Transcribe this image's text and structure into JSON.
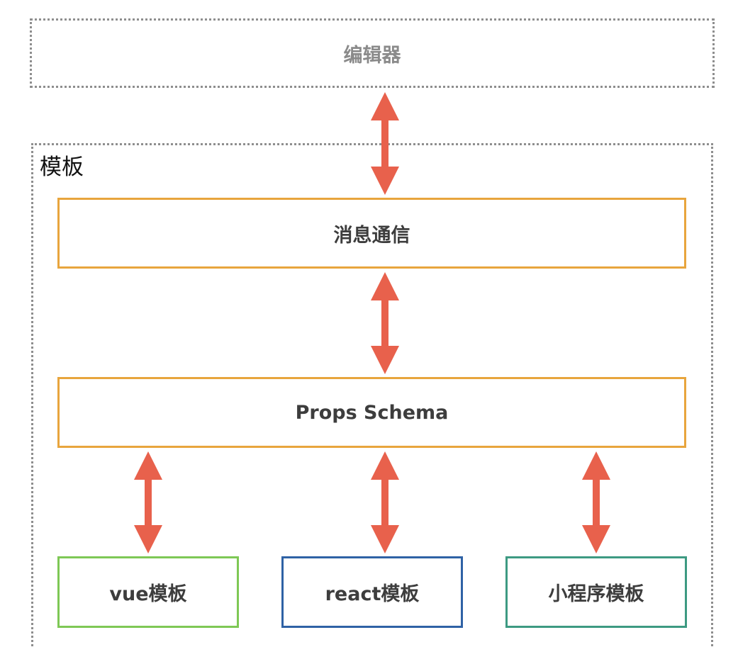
{
  "editor": {
    "label": "编辑器"
  },
  "template": {
    "label": "模板",
    "messaging": {
      "label": "消息通信"
    },
    "props_schema": {
      "label": "Props Schema"
    },
    "targets": [
      {
        "label": "vue模板",
        "border_color": "#7ec855"
      },
      {
        "label": "react模板",
        "border_color": "#2f62a5"
      },
      {
        "label": "小程序模板",
        "border_color": "#3d9a82"
      }
    ]
  },
  "colors": {
    "arrow": "#e8614c",
    "layer_border": "#e8a53d",
    "dotted_border": "#8e8e8e"
  },
  "connections": [
    {
      "from": "editor",
      "to": "messaging",
      "direction": "bidirectional"
    },
    {
      "from": "messaging",
      "to": "props_schema",
      "direction": "bidirectional"
    },
    {
      "from": "props_schema",
      "to": "vue",
      "direction": "bidirectional"
    },
    {
      "from": "props_schema",
      "to": "react",
      "direction": "bidirectional"
    },
    {
      "from": "props_schema",
      "to": "miniapp",
      "direction": "bidirectional"
    }
  ]
}
